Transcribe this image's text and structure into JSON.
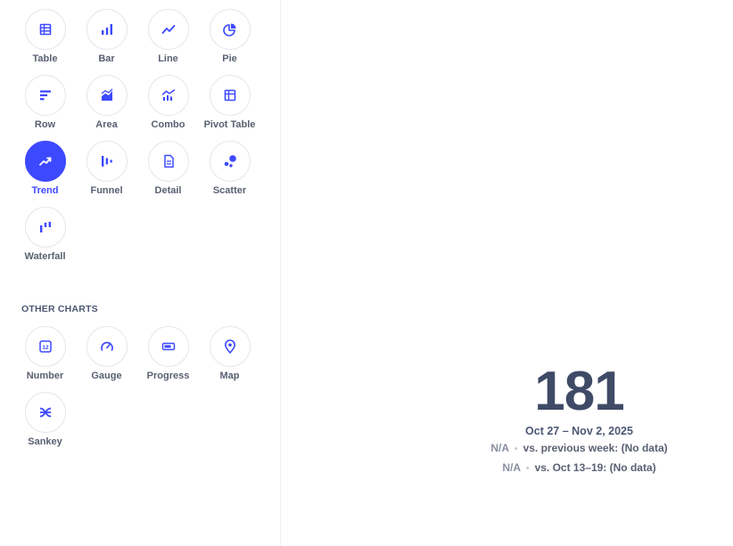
{
  "sidebar": {
    "charts": [
      {
        "id": "table",
        "label": "Table",
        "icon": "table-icon"
      },
      {
        "id": "bar",
        "label": "Bar",
        "icon": "bar-chart-icon"
      },
      {
        "id": "line",
        "label": "Line",
        "icon": "line-chart-icon"
      },
      {
        "id": "pie",
        "label": "Pie",
        "icon": "pie-chart-icon"
      },
      {
        "id": "row",
        "label": "Row",
        "icon": "row-chart-icon"
      },
      {
        "id": "area",
        "label": "Area",
        "icon": "area-chart-icon"
      },
      {
        "id": "combo",
        "label": "Combo",
        "icon": "combo-chart-icon"
      },
      {
        "id": "pivot",
        "label": "Pivot Table",
        "icon": "pivot-table-icon"
      },
      {
        "id": "trend",
        "label": "Trend",
        "icon": "trend-icon",
        "selected": true
      },
      {
        "id": "funnel",
        "label": "Funnel",
        "icon": "funnel-icon"
      },
      {
        "id": "detail",
        "label": "Detail",
        "icon": "detail-icon"
      },
      {
        "id": "scatter",
        "label": "Scatter",
        "icon": "scatter-icon"
      },
      {
        "id": "waterfall",
        "label": "Waterfall",
        "icon": "waterfall-icon"
      }
    ],
    "other_title": "OTHER CHARTS",
    "other_charts": [
      {
        "id": "number",
        "label": "Number",
        "icon": "number-icon"
      },
      {
        "id": "gauge",
        "label": "Gauge",
        "icon": "gauge-icon"
      },
      {
        "id": "progress",
        "label": "Progress",
        "icon": "progress-icon"
      },
      {
        "id": "map",
        "label": "Map",
        "icon": "map-pin-icon"
      },
      {
        "id": "sankey",
        "label": "Sankey",
        "icon": "sankey-icon"
      }
    ]
  },
  "trend": {
    "value": "181",
    "range": "Oct 27 – Nov 2, 2025",
    "comparisons": [
      {
        "na": "N/A",
        "text": "vs. previous week: (No data)"
      },
      {
        "na": "N/A",
        "text": "vs. Oct 13–19: (No data)"
      }
    ]
  },
  "colors": {
    "accent": "#3d49ff",
    "text": "#4c5773",
    "muted": "#8a90a2"
  }
}
